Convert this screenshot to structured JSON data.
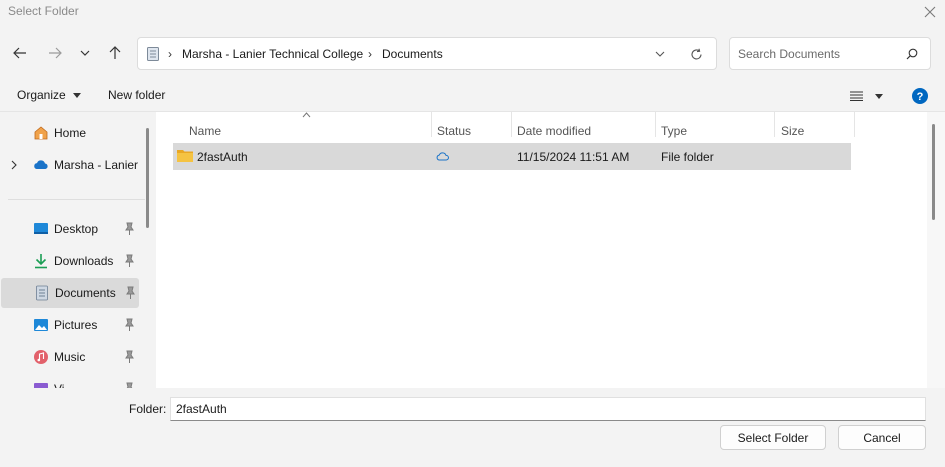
{
  "window": {
    "title": "Select Folder"
  },
  "address": {
    "crumbs": [
      "Marsha - Lanier Technical College",
      "Documents"
    ]
  },
  "search": {
    "placeholder": "Search Documents"
  },
  "commandbar": {
    "organize": "Organize",
    "new_folder": "New folder"
  },
  "nav": {
    "items": [
      {
        "label": "Home",
        "icon": "home-icon"
      },
      {
        "label": "Marsha - Lanier",
        "icon": "cloud-icon"
      },
      {
        "label": "Desktop",
        "icon": "desktop-icon",
        "pinned": true
      },
      {
        "label": "Downloads",
        "icon": "download-icon",
        "pinned": true
      },
      {
        "label": "Documents",
        "icon": "document-icon",
        "pinned": true,
        "selected": true
      },
      {
        "label": "Pictures",
        "icon": "pictures-icon",
        "pinned": true
      },
      {
        "label": "Music",
        "icon": "music-icon",
        "pinned": true
      },
      {
        "label": "Vi",
        "icon": "videos-icon",
        "pinned": true
      }
    ]
  },
  "filelist": {
    "columns": [
      "Name",
      "Status",
      "Date modified",
      "Type",
      "Size"
    ],
    "rows": [
      {
        "name": "2fastAuth",
        "status_icon": "cloud-status-icon",
        "date": "11/15/2024 11:51 AM",
        "type": "File folder",
        "size": ""
      }
    ]
  },
  "footer": {
    "folder_label": "Folder:",
    "folder_value": "2fastAuth",
    "select_button": "Select Folder",
    "cancel_button": "Cancel"
  },
  "colors": {
    "accent": "#0067c0",
    "selection": "#d9d9d9",
    "folder": "#f5c342"
  }
}
